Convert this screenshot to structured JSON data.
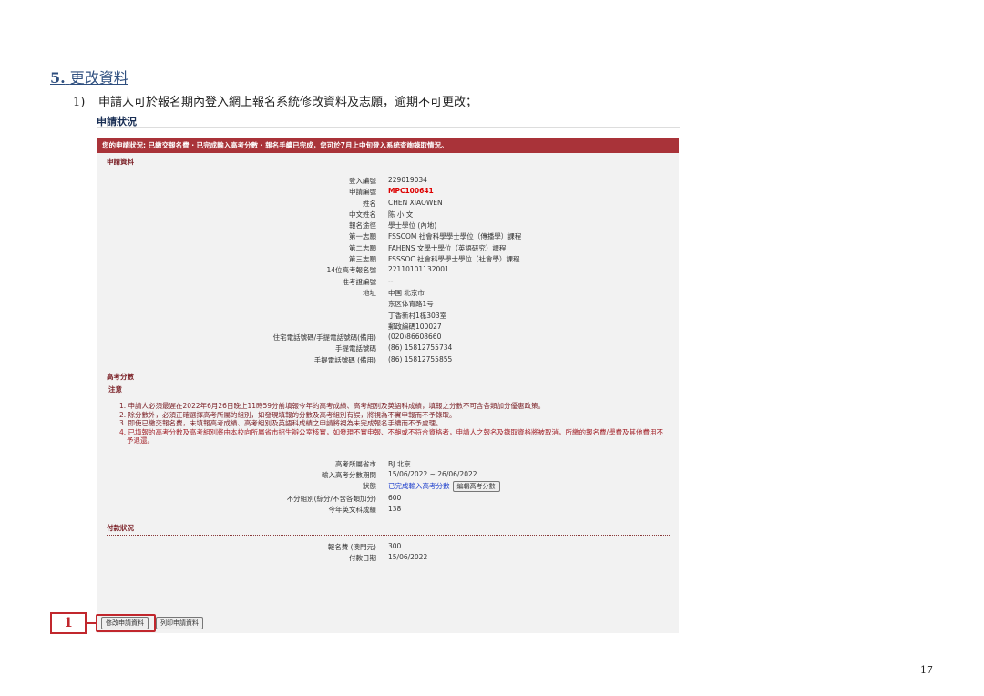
{
  "section": {
    "number": "5.",
    "title": "更改資料"
  },
  "step": {
    "num": "1)",
    "text": "申請人可於報名期內登入網上報名系統修改資料及志願，逾期不可更改；"
  },
  "status_heading": "申請狀況",
  "banner": "您的申請狀況: 已繳交報名費 · 已完成輸入高考分數 · 報名手續已完成，您可於7月上中旬登入系統查詢錄取情況。",
  "application": {
    "heading": "申請資料",
    "fields": [
      {
        "label": "登入編號",
        "value": "229019034"
      },
      {
        "label": "申請編號",
        "value": "MPC100641"
      },
      {
        "label": "姓名",
        "value": "CHEN XIAOWEN"
      },
      {
        "label": "中文姓名",
        "value": "陈 小 文"
      },
      {
        "label": "報名途徑",
        "value": "學士學位 (內地)"
      },
      {
        "label": "第一志願",
        "value": "FSSCOM 社會科學學士學位（傳播學）課程"
      },
      {
        "label": "第二志願",
        "value": "FAHENS 文學士學位（英語研究）課程"
      },
      {
        "label": "第三志願",
        "value": "FSSSOC 社會科學學士學位（社會學）課程"
      },
      {
        "label": "14位高考報名號",
        "value": "22110101132001"
      },
      {
        "label": "准考證編號",
        "value": "--"
      },
      {
        "label": "地址",
        "value": "中国 北京市"
      },
      {
        "label": "",
        "value": "东区体育路1号"
      },
      {
        "label": "",
        "value": "丁香新村1栋303室"
      },
      {
        "label": "",
        "value": "郵政編碼100027"
      },
      {
        "label": "住宅電話號碼/手提電話號碼(備用)",
        "value": "(020)86608660"
      },
      {
        "label": "手提電話號碼",
        "value": "(86) 15812755734"
      },
      {
        "label": "手提電話號碼 (備用)",
        "value": "(86) 15812755855"
      }
    ]
  },
  "gaokao": {
    "heading": "高考分數",
    "notes_heading": "注意",
    "notes": [
      "1. 申請人必須最遲在2022年6月26日晚上11時59分前填報今年的高考成績、高考組別及英語科成績，填報之分數不可含各類加分優惠政策。",
      "2. 除分數外，必須正確選擇高考所屬的組別，如發現填報的分數及高考組別有誤，將視為不實申報而不予錄取。",
      "3. 即使已繳交報名費，未填報高考成績、高考組別及英語科成績之申請將視為未完成報名手續而不予處理。",
      "4. 已填報的高考分數及高考組別將由本校向所屬省市招生辦公室核實，如發現不實申報、不齙或不符合資格者，申請人之報名及錄取資格將被取消，所繳的報名費/學費及其他費用不",
      "予退還。"
    ],
    "fields": [
      {
        "label": "高考所屬省市",
        "value": "BJ 北京"
      },
      {
        "label": "輸入高考分數期間",
        "value": "15/06/2022 ~ 26/06/2022"
      },
      {
        "label": "狀態",
        "value": "已完成輸入高考分數",
        "button": "編輯高考分數"
      },
      {
        "label": "不分組別(綜分/不含各類加分)",
        "value": "600"
      },
      {
        "label": "今年英文科成績",
        "value": "138"
      }
    ]
  },
  "payment": {
    "heading": "付款狀況",
    "fields": [
      {
        "label": "報名費 (澳門元)",
        "value": "300"
      },
      {
        "label": "付款日期",
        "value": "15/06/2022"
      }
    ]
  },
  "actions": {
    "modify": "修改申請資料",
    "print": "列印申請資料"
  },
  "callout": "1",
  "page_number": "17",
  "colors": {
    "banner": "#a93339",
    "callout": "#c1272d",
    "heading_text": "#2f4f7f"
  }
}
